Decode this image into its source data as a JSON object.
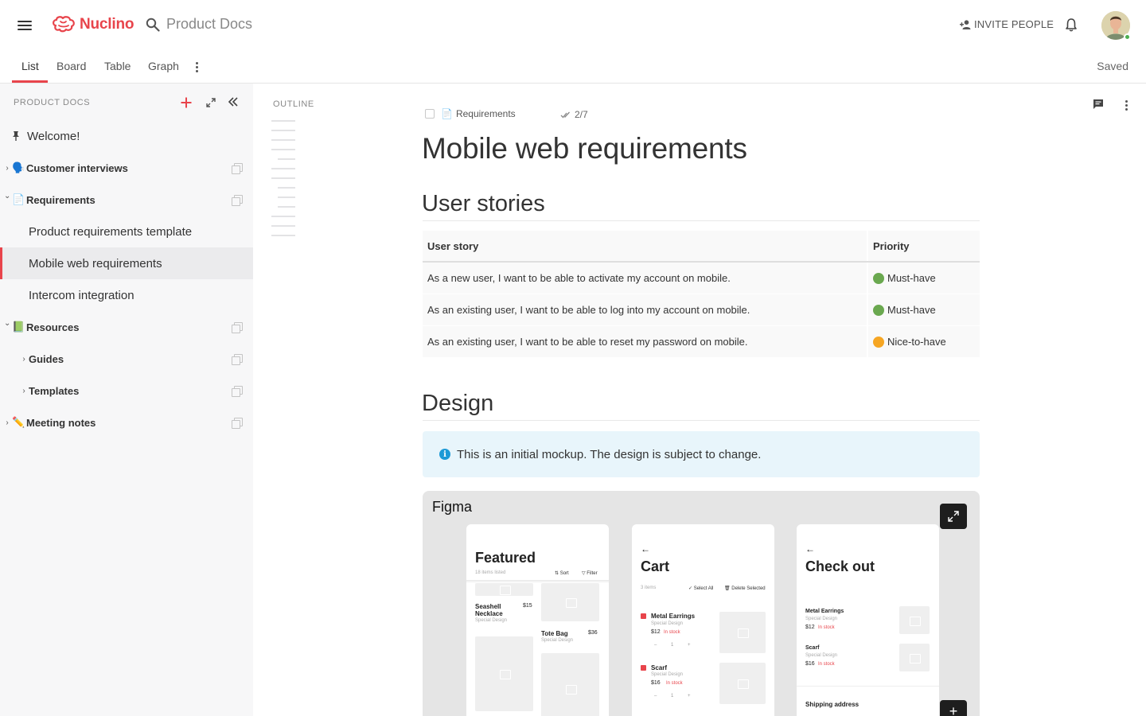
{
  "header": {
    "logo_text": "Nuclino",
    "search_text": "Product Docs",
    "invite_label": "INVITE PEOPLE",
    "brand_color": "#e8444b"
  },
  "tabs": {
    "items": [
      {
        "label": "List"
      },
      {
        "label": "Board"
      },
      {
        "label": "Table"
      },
      {
        "label": "Graph"
      }
    ],
    "active": "List",
    "status": "Saved"
  },
  "sidebar": {
    "header": "PRODUCT DOCS",
    "items": [
      {
        "label": "Welcome!",
        "emoji": "📌"
      },
      {
        "label": "Customer interviews",
        "emoji": "🗣️",
        "arrow": "›"
      },
      {
        "label": "Requirements",
        "emoji": "📄",
        "arrow": "⌄"
      },
      {
        "label": "Product requirements template"
      },
      {
        "label": "Mobile web requirements"
      },
      {
        "label": "Intercom integration"
      },
      {
        "label": "Resources",
        "emoji": "📗",
        "arrow": "⌄"
      },
      {
        "label": "Guides",
        "arrow": "›"
      },
      {
        "label": "Templates",
        "arrow": "›"
      },
      {
        "label": "Meeting notes",
        "emoji": "✏️",
        "arrow": "›"
      }
    ]
  },
  "outline": {
    "label": "OUTLINE"
  },
  "doc": {
    "breadcrumb": "Requirements",
    "breadcrumb_emoji": "📄",
    "progress": "2/7",
    "title": "Mobile web requirements",
    "section1": "User stories",
    "table": {
      "headers": [
        "User story",
        "Priority"
      ],
      "rows": [
        {
          "story": "As a new user, I want to be able to activate my account on mobile.",
          "priority": "Must-have",
          "color": "#6aa84f"
        },
        {
          "story": "As an existing user, I want to be able to log into my account on mobile.",
          "priority": "Must-have",
          "color": "#6aa84f"
        },
        {
          "story": "As an existing user, I want to be able to reset my password on mobile.",
          "priority": "Nice-to-have",
          "color": "#f6a623"
        }
      ]
    },
    "section2": "Design",
    "callout": "This is an initial mockup. The design is subject to change.",
    "embed": {
      "label": "Figma",
      "screen1": {
        "title": "Featured",
        "count": "18 items listed",
        "sort": "⇅ Sort",
        "filter": "▽ Filter",
        "item1_name": "Seashell Necklace",
        "item1_price": "$15",
        "item1_sub": "Special Design",
        "item2_name": "Tote Bag",
        "item2_price": "$36",
        "item2_sub": "Special Design"
      },
      "screen2": {
        "back": "←",
        "title": "Cart",
        "count": "3 items",
        "select_all": "✓ Select All",
        "delete": "🗑 Delete Selected",
        "item1_name": "Metal Earrings",
        "item1_sub": "Special Design",
        "item1_price": "$12",
        "item1_stock": "In stock",
        "item2_name": "Scarf",
        "item2_sub": "Special Design",
        "item2_price": "$16",
        "item2_stock": "In stock",
        "stepper": "– 1 +"
      },
      "screen3": {
        "back": "←",
        "title": "Check out",
        "item1_name": "Metal Earrings",
        "item1_sub": "Special Design",
        "item1_price": "$12",
        "item1_stock": "In stock",
        "item2_name": "Scarf",
        "item2_sub": "Special Design",
        "item2_price": "$16",
        "item2_stock": "In stock",
        "shipping": "Shipping address"
      }
    }
  }
}
